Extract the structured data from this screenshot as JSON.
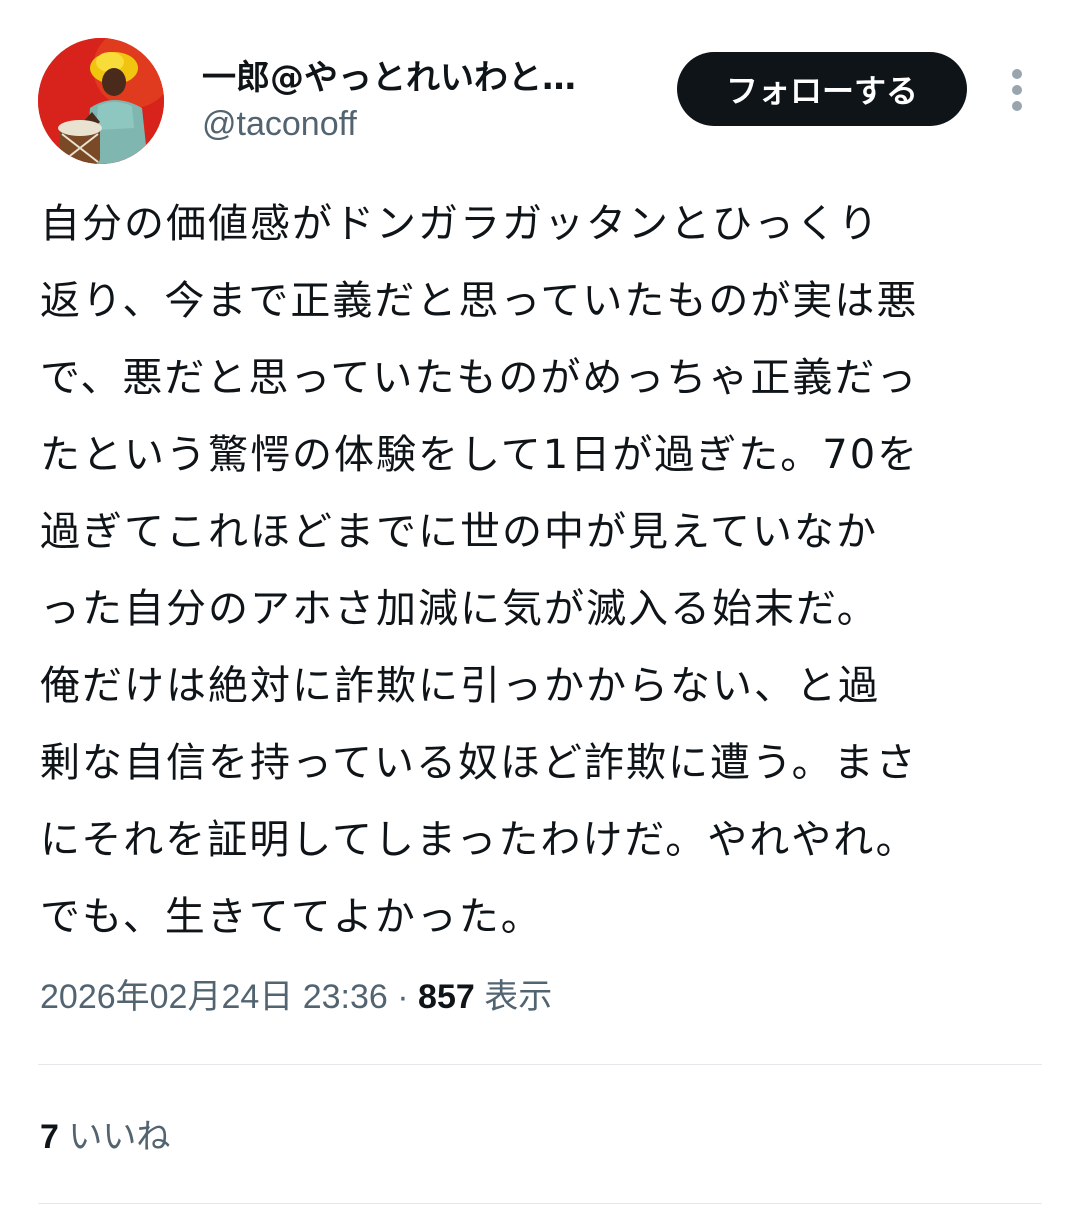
{
  "author": {
    "display_name": "一郎@やっとれいわと…",
    "handle": "@taconoff",
    "avatar_icon": "profile-photo-drummer"
  },
  "actions": {
    "follow_label": "フォローする",
    "more_icon": "more-vertical-icon"
  },
  "tweet": {
    "lines": [
      "自分の価値感がドンガラガッタンとひっくり",
      "返り、今まで正義だと思っていたものが実は悪",
      "で、悪だと思っていたものがめっちゃ正義だっ",
      "たという驚愕の体験をして1日が過ぎた。70を",
      "過ぎてこれほどまでに世の中が見えていなか",
      "った自分のアホさ加減に気が滅入る始末だ。",
      "俺だけは絶対に詐欺に引っかからない、と過",
      "剰な自信を持っている奴ほど詐欺に遭う。まさ",
      "にそれを証明してしまったわけだ。やれやれ。",
      "でも、生きててよかった。"
    ]
  },
  "meta": {
    "timestamp": "2026年02月24日 23:36",
    "separator": " · ",
    "views_count": "857",
    "views_label": " 表示"
  },
  "engagement": {
    "likes_count": "7",
    "likes_label": " いいね"
  },
  "colors": {
    "text_primary": "#0f1419",
    "text_secondary": "#536471",
    "button_bg": "#0f1419",
    "avatar_bg": "#d8231c",
    "divider": "#e6e9eb"
  }
}
